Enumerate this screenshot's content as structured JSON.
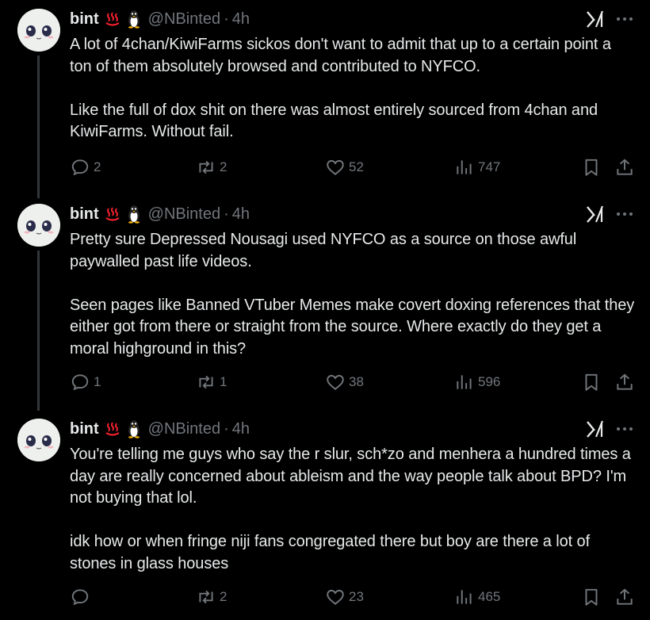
{
  "tweets": [
    {
      "name": "bint",
      "handle": "@NBinted",
      "time": "4h",
      "text": "A lot of 4chan/KiwiFarms sickos don't want to admit that up to a certain point a ton of them absolutely browsed and contributed to NYFCO.\n\nLike the full of dox shit on there was almost entirely sourced from 4chan and KiwiFarms. Without fail.",
      "replies": "2",
      "reposts": "2",
      "likes": "52",
      "views": "747"
    },
    {
      "name": "bint",
      "handle": "@NBinted",
      "time": "4h",
      "text": "Pretty sure Depressed Nousagi used NYFCO as a source on those awful paywalled past life videos.\n\nSeen pages like Banned VTuber Memes make covert doxing references that they either got from there or straight from the source. Where exactly do they get a moral highground in this?",
      "replies": "1",
      "reposts": "1",
      "likes": "38",
      "views": "596"
    },
    {
      "name": "bint",
      "handle": "@NBinted",
      "time": "4h",
      "text": "You're telling me guys who say the r slur, sch*zo and menhera a hundred times a day are really concerned about ableism and the way people talk about BPD? I'm not buying that lol.\n\nidk how or when fringe niji fans congregated there but boy are there a lot of stones in glass houses",
      "replies": "",
      "reposts": "2",
      "likes": "23",
      "views": "465"
    }
  ],
  "separator": "·",
  "icons": {
    "name_emoji_1": "hot-springs-icon",
    "name_emoji_2": "penguin-icon",
    "grok": "grok-icon",
    "more": "more-dots-icon",
    "reply": "reply-icon",
    "repost": "repost-icon",
    "like": "heart-icon",
    "views": "views-icon",
    "bookmark": "bookmark-icon",
    "share": "share-icon"
  },
  "colors": {
    "background": "#000000",
    "text": "#e7e9ea",
    "muted": "#71767b",
    "hot_springs": "#f4212e"
  }
}
